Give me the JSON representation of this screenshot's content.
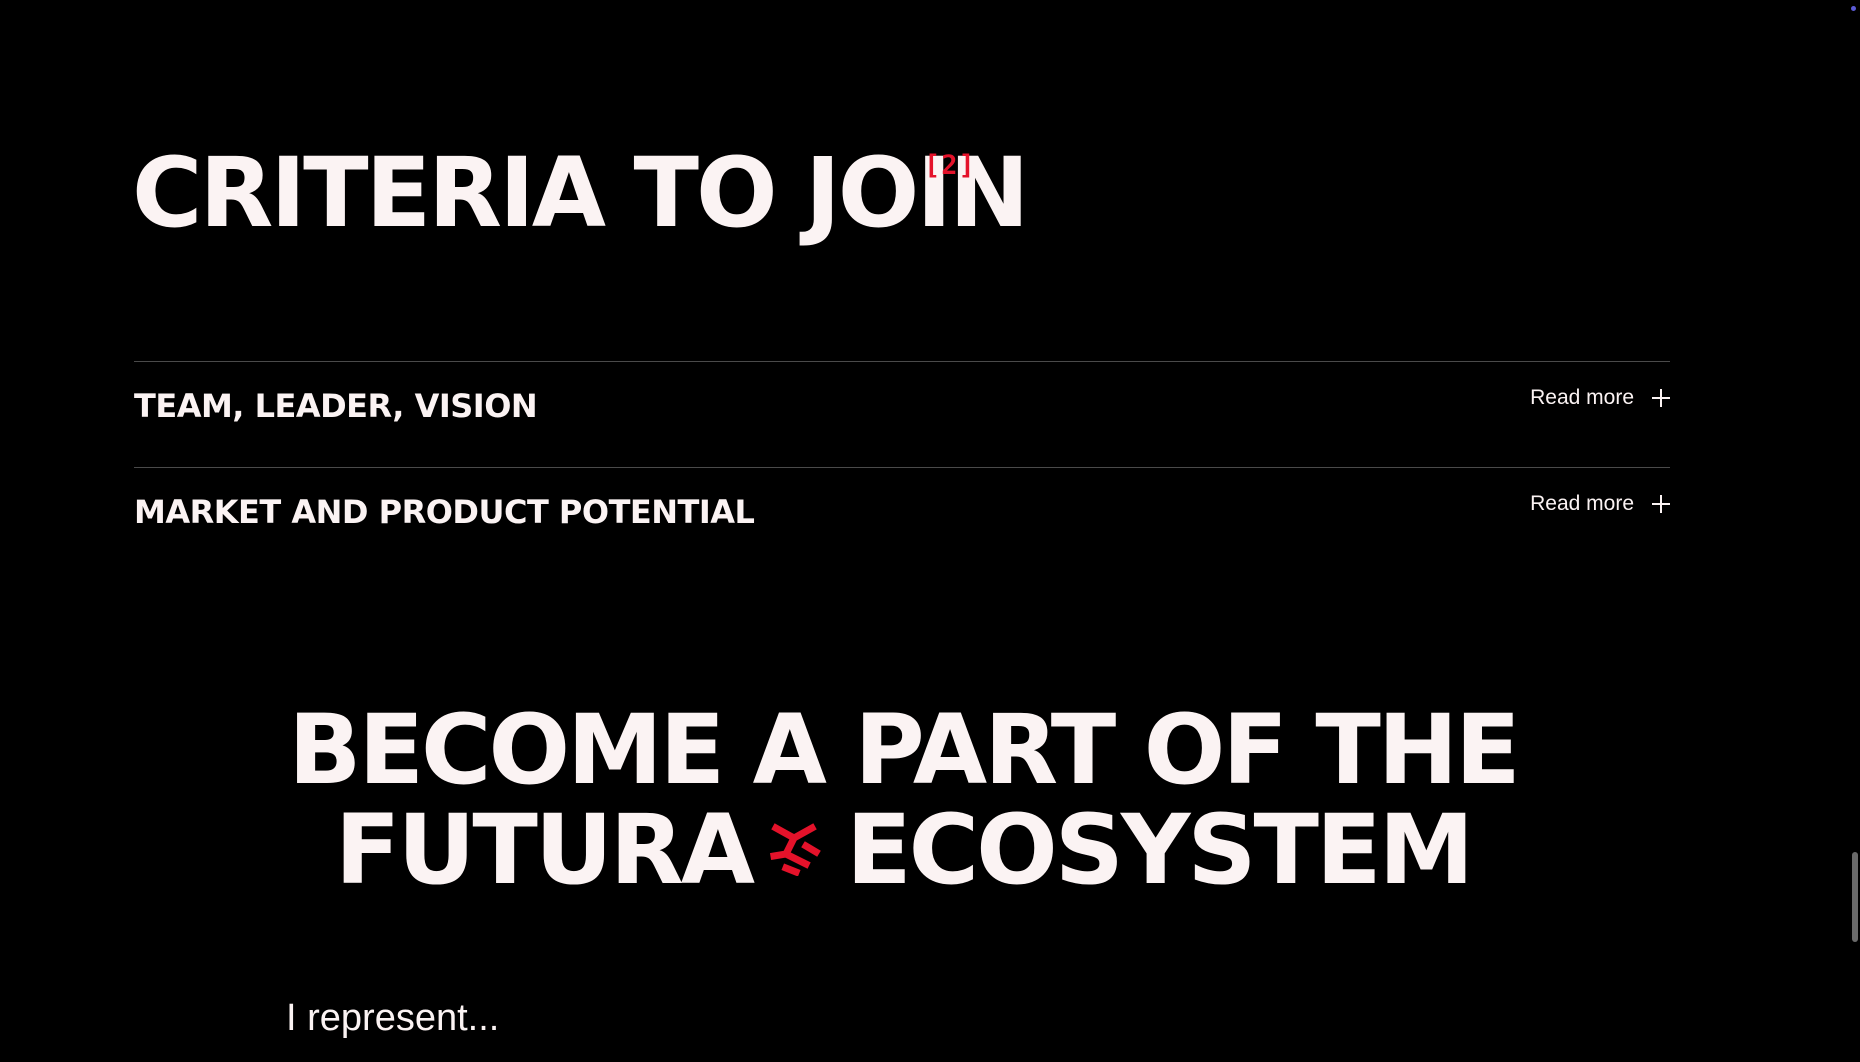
{
  "criteria": {
    "heading": "CRITERIA TO JOIN",
    "footnote": "[2]"
  },
  "accordion": {
    "items": [
      {
        "title": "TEAM, LEADER, VISION",
        "toggle_label": "Read more",
        "toggle_icon": "plus-icon"
      },
      {
        "title": "MARKET AND PRODUCT POTENTIAL",
        "toggle_label": "Read more",
        "toggle_icon": "plus-icon"
      }
    ]
  },
  "cta": {
    "line1": "BECOME A PART OF THE",
    "line2_before": "FUTURA",
    "line2_icon": "futura-logo-icon",
    "line2_after": "ECOSYSTEM"
  },
  "represent": {
    "label": "I represent..."
  },
  "colors": {
    "background": "#000000",
    "text": "#fbf3f3",
    "accent": "#e4122a",
    "divider": "#4a4a4a"
  }
}
